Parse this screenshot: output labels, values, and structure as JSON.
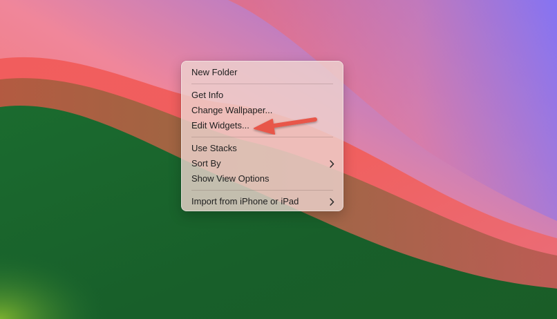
{
  "context_menu": {
    "new_folder": "New Folder",
    "get_info": "Get Info",
    "change_wallpaper": "Change Wallpaper...",
    "edit_widgets": "Edit Widgets...",
    "use_stacks": "Use Stacks",
    "sort_by": "Sort By",
    "show_view_options": "Show View Options",
    "import_from_iphone": "Import from iPhone or iPad"
  },
  "icons": {
    "submenu": "chevron-right-icon",
    "annotation": "red-arrow-icon"
  },
  "colors": {
    "annotation_arrow": "#e8574a",
    "menu_background": "#eed4d0",
    "wallpaper_green": "#1f6a30",
    "wallpaper_coral": "#f26a5c",
    "wallpaper_purple": "#8a72e6"
  }
}
